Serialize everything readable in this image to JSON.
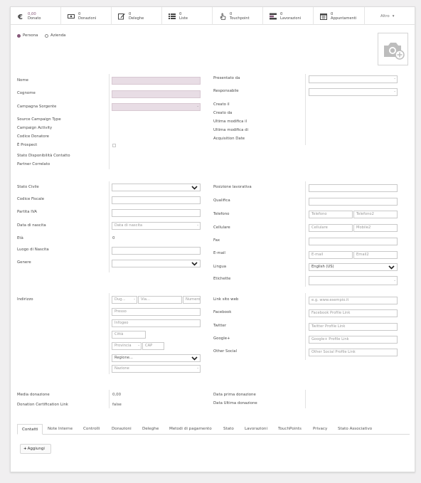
{
  "colors": {
    "accent": "#875a7b",
    "required_bg": "#e8dde5"
  },
  "smart_buttons": [
    {
      "icon": "euro-icon",
      "count": "0,00",
      "label": "Donato"
    },
    {
      "icon": "banknote-icon",
      "count": "0",
      "label": "Donazioni"
    },
    {
      "icon": "edit-icon",
      "count": "0",
      "label": "Deleghe"
    },
    {
      "icon": "list-icon",
      "count": "0",
      "label": "Liste"
    },
    {
      "icon": "hand-pointer-icon",
      "count": "0",
      "label": "Touchpoint"
    },
    {
      "icon": "tasks-icon",
      "count": "0",
      "label": "Lavorazioni"
    },
    {
      "icon": "calendar-icon",
      "count": "0",
      "label": "Appuntamenti"
    }
  ],
  "more_label": "Altro",
  "company_type": {
    "persona": "Persona",
    "azienda": "Azienda"
  },
  "left1": {
    "nome": "Nome",
    "cognome": "Cognome",
    "campagna": "Campagna Sorgente",
    "source_type": "Source Campaign Type",
    "campaign_activity": "Campaign Activity",
    "codice_donatore": "Codice Donatore",
    "prospect": "È Prospect",
    "stato_disp": "Stato Disponibilità Contatto",
    "partner": "Partner Correlato"
  },
  "right1": {
    "presentato": "Presentato da",
    "responsabile": "Responsabile",
    "creato_il": "Creato il",
    "creato_da": "Creato da",
    "ultima_il": "Ultima modifica il",
    "ultima_di": "Ultima modifica di",
    "acquisition": "Acquisition Date"
  },
  "left2": {
    "stato_civile": "Stato Civile",
    "codice_fiscale": "Codice Fiscale",
    "partita_iva": "Partita IVA",
    "data_nascita": "Data di nascita",
    "data_nascita_ph": "Data di nascita",
    "eta": "Età",
    "eta_value": "0",
    "luogo": "Luogo di Nascita",
    "genere": "Genere"
  },
  "right2": {
    "posizione": "Posizione lavorativa",
    "qualifica": "Qualifica",
    "telefono": "Telefono",
    "telefono_ph": "Telefono",
    "telefono2_ph": "Telefono2",
    "cellulare": "Cellulare",
    "cellulare_ph": "Cellulare",
    "mobile2_ph": "Mobile2",
    "fax": "Fax",
    "email": "E-mail",
    "email_ph": "E-mail",
    "email2_ph": "Email2",
    "lingua": "Lingua",
    "lingua_value": "English (US)",
    "etichette": "Etichette"
  },
  "address": {
    "label": "Indirizzo",
    "dug": "Dug...",
    "via": "Via...",
    "numero": "Numero",
    "presso": "Presso",
    "infogeo": "Infogeo",
    "citta": "Città",
    "provincia": "Provincia",
    "cap": "CAP",
    "regione": "Regione...",
    "nazione": "Nazione"
  },
  "web": {
    "link_label": "Link sito web",
    "link_ph": "e.g. www.esempio.it",
    "facebook": "Facebook",
    "facebook_ph": "Facebook Profile Link",
    "twitter": "Twitter",
    "twitter_ph": "Twitter Profile Link",
    "google": "Google+",
    "google_ph": "Google+ Profile Link",
    "other": "Other Social",
    "other_ph": "Other Social Profile Link"
  },
  "stats": {
    "media": "Media donazione",
    "media_value": "0,00",
    "cert": "Donation Certification Link",
    "cert_value": "false",
    "prima": "Data prima donazione",
    "ultima": "Data Ultima donazione"
  },
  "tabs": [
    "Contatti",
    "Note Interne",
    "Controlli",
    "Donazioni",
    "Deleghe",
    "Metodi di pagamento",
    "Stato",
    "Lavorazioni",
    "TouchPoints",
    "Privacy",
    "Stato Associativo"
  ],
  "add_label": "Aggiungi"
}
